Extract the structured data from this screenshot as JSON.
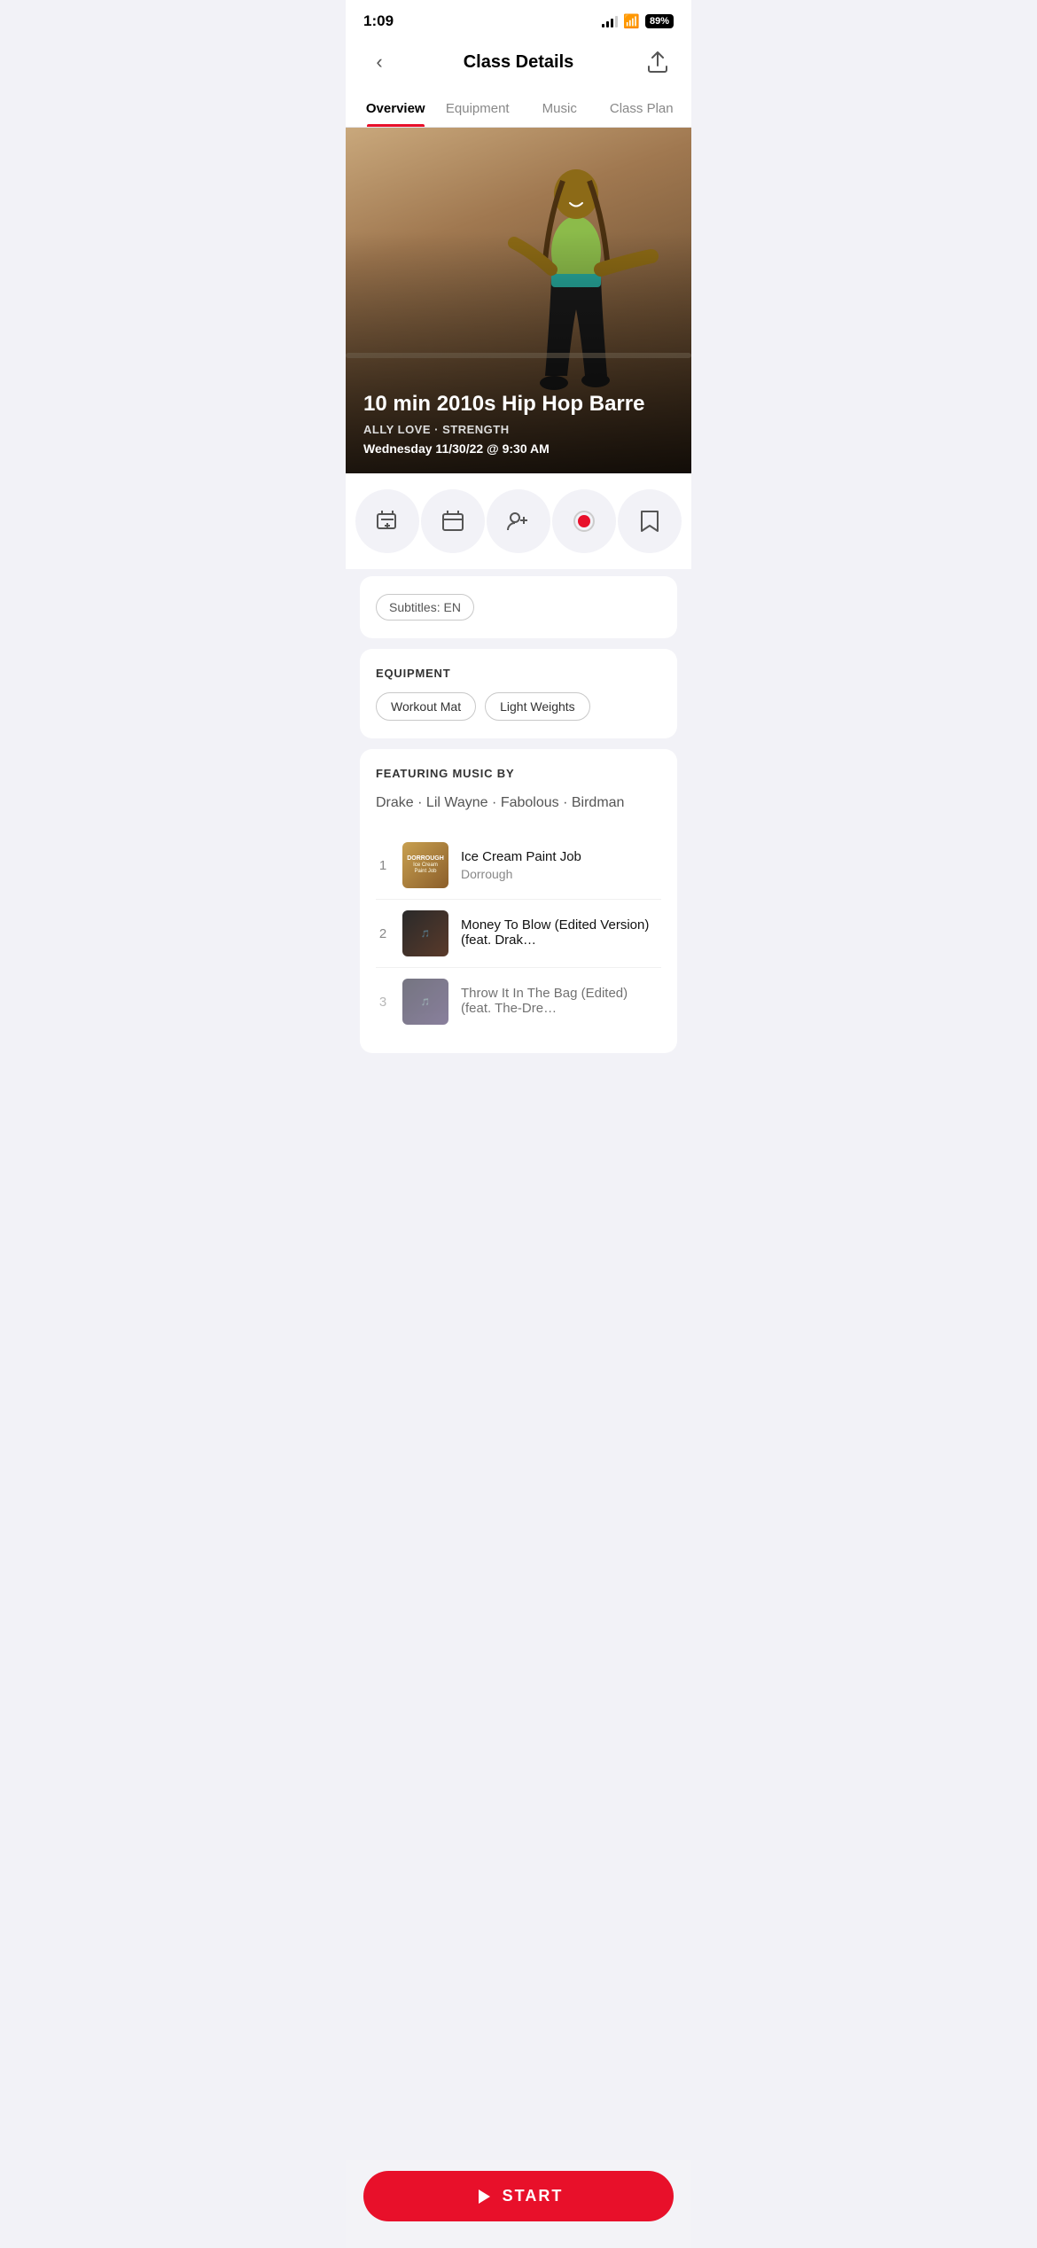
{
  "statusBar": {
    "time": "1:09",
    "battery": "89",
    "signal": [
      4,
      7,
      10,
      13
    ],
    "wifiSymbol": "wifi"
  },
  "header": {
    "title": "Class Details",
    "backLabel": "<",
    "shareLabel": "share"
  },
  "tabs": [
    {
      "id": "overview",
      "label": "Overview",
      "active": true
    },
    {
      "id": "equipment",
      "label": "Equipment",
      "active": false
    },
    {
      "id": "music",
      "label": "Music",
      "active": false
    },
    {
      "id": "classplan",
      "label": "Class Plan",
      "active": false
    }
  ],
  "hero": {
    "title": "10 min 2010s Hip Hop Barre",
    "instructor": "ALLY LOVE",
    "type": "STRENGTH",
    "date": "Wednesday 11/30/22 @ 9:30 AM"
  },
  "actions": [
    {
      "id": "add-to-stack",
      "icon": "⊞"
    },
    {
      "id": "schedule",
      "icon": "📅"
    },
    {
      "id": "friends",
      "icon": "👥"
    },
    {
      "id": "record",
      "icon": "⏺"
    },
    {
      "id": "bookmark",
      "icon": "🔖"
    }
  ],
  "subtitles": {
    "label": "Subtitles: EN"
  },
  "equipment": {
    "sectionLabel": "EQUIPMENT",
    "items": [
      "Workout Mat",
      "Light Weights"
    ]
  },
  "music": {
    "sectionLabel": "FEATURING MUSIC BY",
    "artists": [
      "Drake",
      "Lil Wayne",
      "Fabolous",
      "Birdman"
    ],
    "tracks": [
      {
        "num": "1",
        "title": "Ice Cream Paint Job",
        "artist": "Dorrough",
        "artColor1": "#c8a050",
        "artColor2": "#8b5e2a"
      },
      {
        "num": "2",
        "title": "Money To Blow (Edited Version) (feat. Drak…",
        "artist": "",
        "artColor1": "#2a2a2a",
        "artColor2": "#5a3a2a"
      },
      {
        "num": "3",
        "title": "Throw It In The Bag (Edited) (feat. The-Dre…",
        "artist": "",
        "artColor1": "#1a1a2e",
        "artColor2": "#3a2a5a"
      }
    ]
  },
  "startButton": {
    "label": "START"
  }
}
